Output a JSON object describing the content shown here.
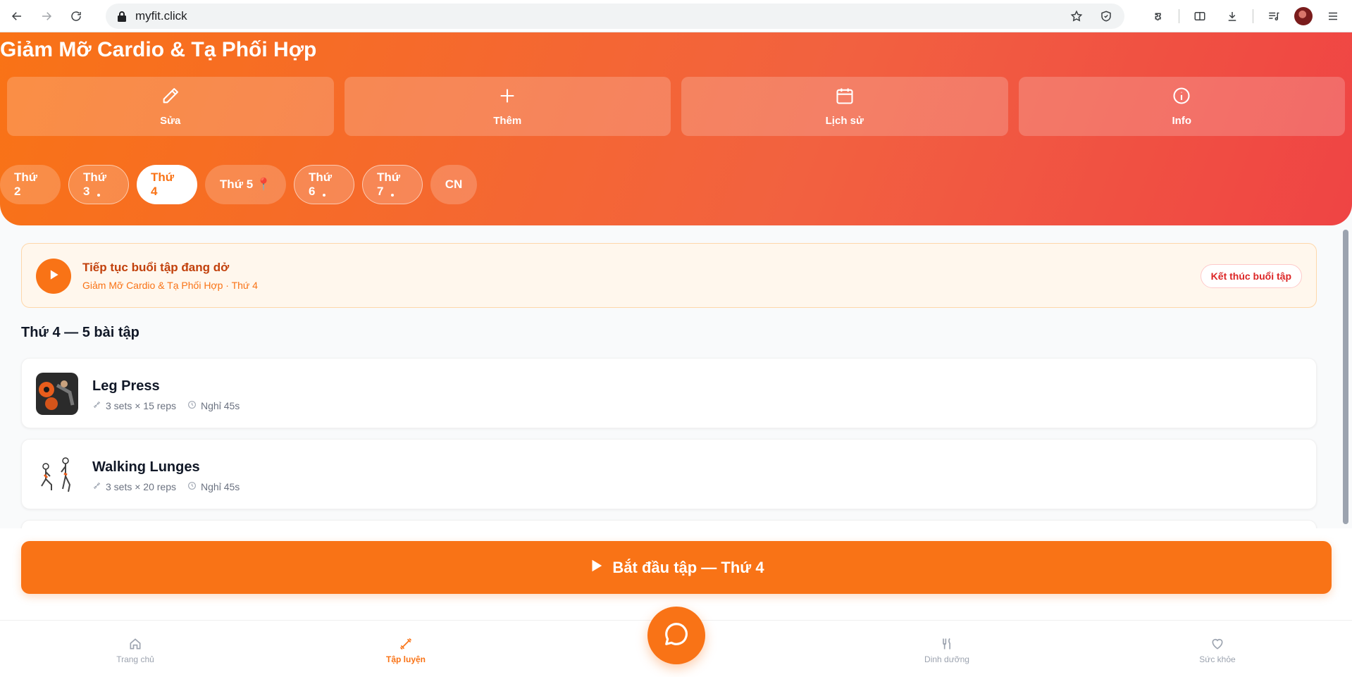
{
  "browser": {
    "url": "myfit.click"
  },
  "header": {
    "title": "Giảm Mỡ Cardio & Tạ Phối Hợp",
    "actions": [
      {
        "label": "Sửa",
        "icon": "pencil-icon"
      },
      {
        "label": "Thêm",
        "icon": "plus-icon"
      },
      {
        "label": "Lịch sử",
        "icon": "calendar-icon"
      },
      {
        "label": "Info",
        "icon": "info-icon"
      }
    ],
    "days": [
      {
        "label": "Thứ 2",
        "dot": false,
        "active": false
      },
      {
        "label": "Thứ 3",
        "dot": true,
        "active": false
      },
      {
        "label": "Thứ 4",
        "dot": false,
        "active": true
      },
      {
        "label": "Thứ 5 📍",
        "dot": false,
        "active": false
      },
      {
        "label": "Thứ 6",
        "dot": true,
        "active": false
      },
      {
        "label": "Thứ 7",
        "dot": true,
        "active": false
      },
      {
        "label": "CN",
        "dot": false,
        "active": false
      }
    ]
  },
  "resume": {
    "title": "Tiếp tục buổi tập đang dở",
    "subtitle": "Giảm Mỡ Cardio & Tạ Phối Hợp · Thứ 4",
    "end_label": "Kết thúc buổi tập"
  },
  "section": {
    "title": "Thứ 4 — 5 bài tập"
  },
  "exercises": [
    {
      "name": "Leg Press",
      "sets": "3 sets × 15 reps",
      "rest": "Nghỉ 45s"
    },
    {
      "name": "Walking Lunges",
      "sets": "3 sets × 20 reps",
      "rest": "Nghỉ 45s"
    }
  ],
  "start_button": {
    "label": "Bắt đầu tập — Thứ 4"
  },
  "bottom_nav": [
    {
      "label": "Trang chủ",
      "icon": "home-icon",
      "active": false
    },
    {
      "label": "Tập luyện",
      "icon": "dumbbell-icon",
      "active": true
    },
    {
      "label": "Dinh dưỡng",
      "icon": "utensils-icon",
      "active": false
    },
    {
      "label": "Sức khỏe",
      "icon": "heart-icon",
      "active": false
    }
  ],
  "colors": {
    "primary": "#f97316",
    "accent_red": "#ef4444",
    "end_text": "#dc2626"
  }
}
